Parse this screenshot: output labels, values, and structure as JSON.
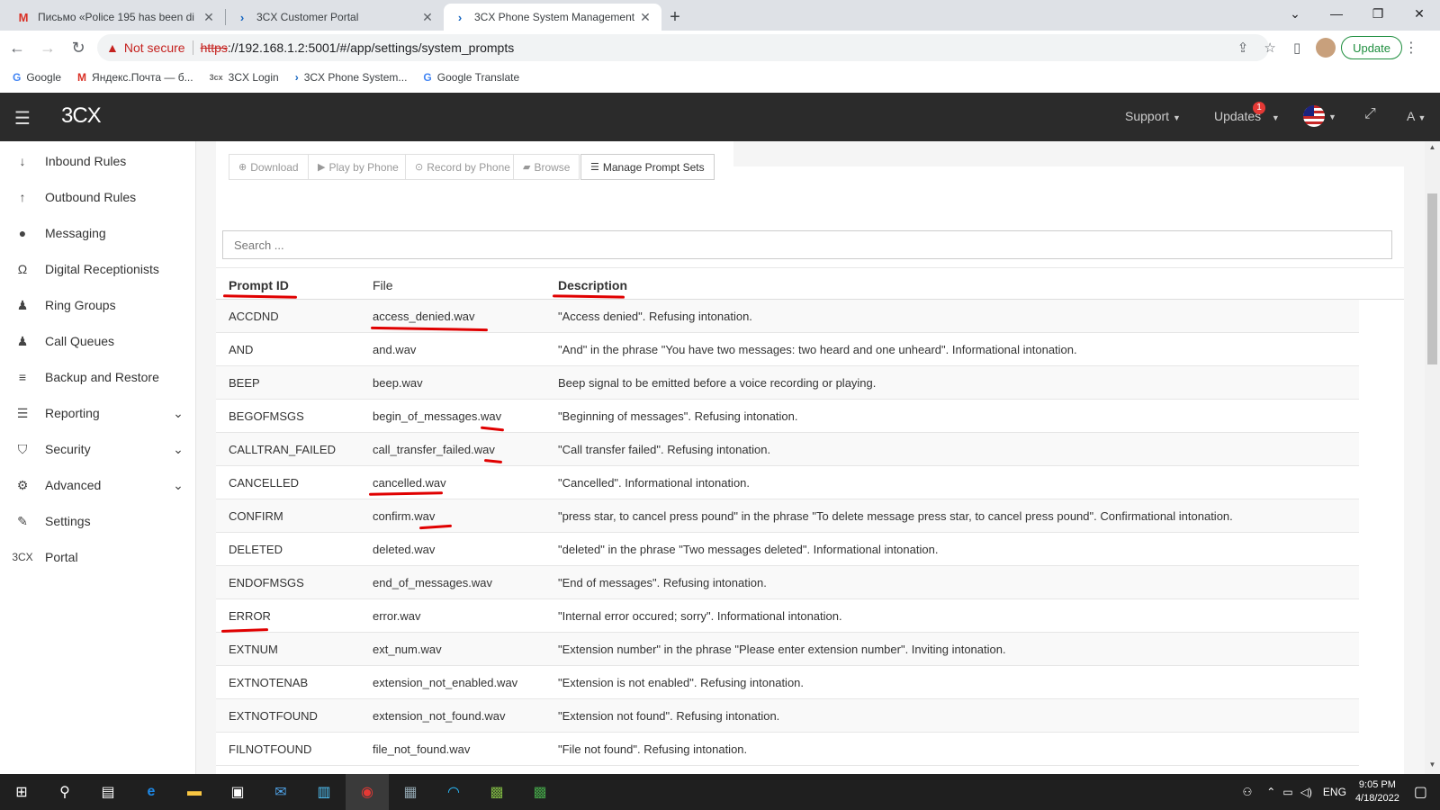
{
  "browser": {
    "tabs": [
      {
        "title": "Письмо «Police 195 has been di",
        "icon": "gmail-icon",
        "active": false
      },
      {
        "title": "3CX Customer Portal",
        "icon": "3cx-icon",
        "active": false
      },
      {
        "title": "3CX Phone System Management",
        "icon": "3cx-icon",
        "active": true
      }
    ],
    "new_tab": "+",
    "security_label": "Not secure",
    "url_scheme": "https",
    "url_rest": "://192.168.1.2:5001/#/app/settings/system_prompts",
    "update_label": "Update",
    "bookmarks": [
      {
        "label": "Google",
        "icon": "G"
      },
      {
        "label": "Яндекс.Почта — б...",
        "icon": "M"
      },
      {
        "label": "3CX Login",
        "icon": "3cx"
      },
      {
        "label": "3CX Phone System...",
        "icon": "›"
      },
      {
        "label": "Google Translate",
        "icon": "G"
      }
    ]
  },
  "app": {
    "logo": "3CX",
    "header": {
      "support": "Support",
      "updates": "Updates",
      "updates_badge": "1",
      "user": "A"
    },
    "sidebar": [
      {
        "label": "Inbound Rules",
        "icon": "arrow-down-icon",
        "glyph": "↓"
      },
      {
        "label": "Outbound Rules",
        "icon": "arrow-up-icon",
        "glyph": "↑"
      },
      {
        "label": "Messaging",
        "icon": "chat-icon",
        "glyph": "●"
      },
      {
        "label": "Digital Receptionists",
        "icon": "headset-icon",
        "glyph": "Ω"
      },
      {
        "label": "Ring Groups",
        "icon": "users-icon",
        "glyph": "♟"
      },
      {
        "label": "Call Queues",
        "icon": "group-icon",
        "glyph": "♟"
      },
      {
        "label": "Backup and Restore",
        "icon": "database-icon",
        "glyph": "≡"
      },
      {
        "label": "Reporting",
        "icon": "list-icon",
        "glyph": "☰",
        "expandable": true
      },
      {
        "label": "Security",
        "icon": "shield-icon",
        "glyph": "⛉",
        "expandable": true
      },
      {
        "label": "Advanced",
        "icon": "gear-icon",
        "glyph": "⚙",
        "expandable": true
      },
      {
        "label": "Settings",
        "icon": "wrench-icon",
        "glyph": "✎"
      },
      {
        "label": "Portal",
        "icon": "3cx-icon",
        "glyph": "3CX"
      }
    ],
    "toolbar": {
      "download": "Download",
      "play_by_phone": "Play by Phone",
      "record_by_phone": "Record by Phone",
      "browse": "Browse",
      "manage_prompt_sets": "Manage Prompt Sets"
    },
    "search_placeholder": "Search ...",
    "table": {
      "columns": [
        "Prompt ID",
        "File",
        "Description"
      ],
      "rows": [
        {
          "id": "ACCDND",
          "file": "access_denied.wav",
          "desc": "\"Access denied\". Refusing intonation."
        },
        {
          "id": "AND",
          "file": "and.wav",
          "desc": "\"And\" in the phrase \"You have two messages: two heard and one unheard\". Informational intonation."
        },
        {
          "id": "BEEP",
          "file": "beep.wav",
          "desc": "Beep signal to be emitted before a voice recording or playing."
        },
        {
          "id": "BEGOFMSGS",
          "file": "begin_of_messages.wav",
          "desc": "\"Beginning of messages\". Refusing intonation."
        },
        {
          "id": "CALLTRAN_FAILED",
          "file": "call_transfer_failed.wav",
          "desc": "\"Call transfer failed\". Refusing intonation."
        },
        {
          "id": "CANCELLED",
          "file": "cancelled.wav",
          "desc": "\"Cancelled\". Informational intonation."
        },
        {
          "id": "CONFIRM",
          "file": "confirm.wav",
          "desc": "\"press star, to cancel press pound\" in the phrase \"To delete message press star, to cancel press pound\". Confirmational intonation."
        },
        {
          "id": "DELETED",
          "file": "deleted.wav",
          "desc": "\"deleted\" in the phrase \"Two messages deleted\". Informational intonation."
        },
        {
          "id": "ENDOFMSGS",
          "file": "end_of_messages.wav",
          "desc": "\"End of messages\". Refusing intonation."
        },
        {
          "id": "ERROR",
          "file": "error.wav",
          "desc": "\"Internal error occured; sorry\". Informational intonation."
        },
        {
          "id": "EXTNUM",
          "file": "ext_num.wav",
          "desc": "\"Extension number\" in the phrase \"Please enter extension number\". Inviting intonation."
        },
        {
          "id": "EXTNOTENAB",
          "file": "extension_not_enabled.wav",
          "desc": "\"Extension is not enabled\". Refusing intonation."
        },
        {
          "id": "EXTNOTFOUND",
          "file": "extension_not_found.wav",
          "desc": "\"Extension not found\". Refusing intonation."
        },
        {
          "id": "FILNOTFOUND",
          "file": "file_not_found.wav",
          "desc": "\"File not found\". Refusing intonation."
        }
      ]
    }
  },
  "taskbar": {
    "language": "ENG",
    "time": "9:05 PM",
    "date": "4/18/2022"
  }
}
